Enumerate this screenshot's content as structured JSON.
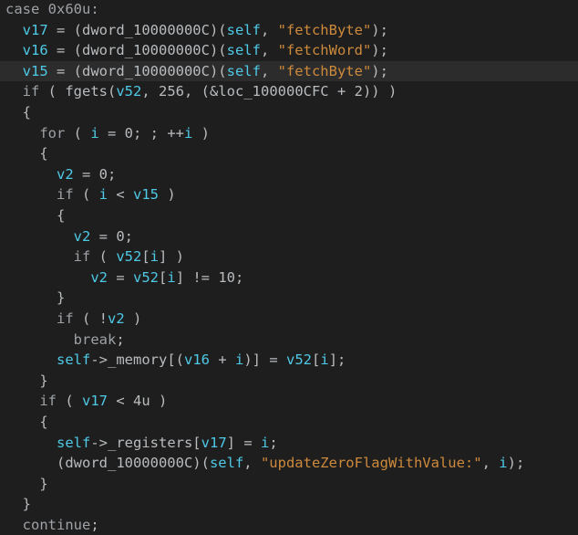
{
  "colors": {
    "background": "#1e1e1e",
    "highlight_line": "#2c2c2c",
    "keyword": "#9ea2a6",
    "variable": "#4ec9e6",
    "string": "#ce8a3c",
    "plain": "#b9bcbf"
  },
  "editor": {
    "highlighted_line": 3,
    "lines": [
      [
        {
          "t": "kw",
          "v": "case 0x60u:"
        }
      ],
      [
        {
          "t": "plain",
          "v": "  "
        },
        {
          "t": "var",
          "v": "v17"
        },
        {
          "t": "plain",
          "v": " = (dword_10000000C)("
        },
        {
          "t": "var",
          "v": "self"
        },
        {
          "t": "plain",
          "v": ", "
        },
        {
          "t": "str",
          "v": "\"fetchByte\""
        },
        {
          "t": "plain",
          "v": ");"
        }
      ],
      [
        {
          "t": "plain",
          "v": "  "
        },
        {
          "t": "var",
          "v": "v16"
        },
        {
          "t": "plain",
          "v": " = (dword_10000000C)("
        },
        {
          "t": "var",
          "v": "self"
        },
        {
          "t": "plain",
          "v": ", "
        },
        {
          "t": "str",
          "v": "\"fetchWord\""
        },
        {
          "t": "plain",
          "v": ");"
        }
      ],
      [
        {
          "t": "plain",
          "v": "  "
        },
        {
          "t": "var",
          "v": "v15"
        },
        {
          "t": "plain",
          "v": " = (dword_10000000C)("
        },
        {
          "t": "var",
          "v": "self"
        },
        {
          "t": "plain",
          "v": ", "
        },
        {
          "t": "str",
          "v": "\"fetchByte\""
        },
        {
          "t": "plain",
          "v": ");"
        }
      ],
      [
        {
          "t": "plain",
          "v": "  "
        },
        {
          "t": "kw",
          "v": "if"
        },
        {
          "t": "plain",
          "v": " ( fgets("
        },
        {
          "t": "var",
          "v": "v52"
        },
        {
          "t": "plain",
          "v": ", 256, (&loc_100000CFC + 2)) )"
        }
      ],
      [
        {
          "t": "plain",
          "v": "  {"
        }
      ],
      [
        {
          "t": "plain",
          "v": "    "
        },
        {
          "t": "kw",
          "v": "for"
        },
        {
          "t": "plain",
          "v": " ( "
        },
        {
          "t": "var",
          "v": "i"
        },
        {
          "t": "plain",
          "v": " = 0; ; ++"
        },
        {
          "t": "var",
          "v": "i"
        },
        {
          "t": "plain",
          "v": " )"
        }
      ],
      [
        {
          "t": "plain",
          "v": "    {"
        }
      ],
      [
        {
          "t": "plain",
          "v": "      "
        },
        {
          "t": "var",
          "v": "v2"
        },
        {
          "t": "plain",
          "v": " = 0;"
        }
      ],
      [
        {
          "t": "plain",
          "v": "      "
        },
        {
          "t": "kw",
          "v": "if"
        },
        {
          "t": "plain",
          "v": " ( "
        },
        {
          "t": "var",
          "v": "i"
        },
        {
          "t": "plain",
          "v": " < "
        },
        {
          "t": "var",
          "v": "v15"
        },
        {
          "t": "plain",
          "v": " )"
        }
      ],
      [
        {
          "t": "plain",
          "v": "      {"
        }
      ],
      [
        {
          "t": "plain",
          "v": "        "
        },
        {
          "t": "var",
          "v": "v2"
        },
        {
          "t": "plain",
          "v": " = 0;"
        }
      ],
      [
        {
          "t": "plain",
          "v": "        "
        },
        {
          "t": "kw",
          "v": "if"
        },
        {
          "t": "plain",
          "v": " ( "
        },
        {
          "t": "var",
          "v": "v52"
        },
        {
          "t": "plain",
          "v": "["
        },
        {
          "t": "var",
          "v": "i"
        },
        {
          "t": "plain",
          "v": "] )"
        }
      ],
      [
        {
          "t": "plain",
          "v": "          "
        },
        {
          "t": "var",
          "v": "v2"
        },
        {
          "t": "plain",
          "v": " = "
        },
        {
          "t": "var",
          "v": "v52"
        },
        {
          "t": "plain",
          "v": "["
        },
        {
          "t": "var",
          "v": "i"
        },
        {
          "t": "plain",
          "v": "] != 10;"
        }
      ],
      [
        {
          "t": "plain",
          "v": "      }"
        }
      ],
      [
        {
          "t": "plain",
          "v": "      "
        },
        {
          "t": "kw",
          "v": "if"
        },
        {
          "t": "plain",
          "v": " ( !"
        },
        {
          "t": "var",
          "v": "v2"
        },
        {
          "t": "plain",
          "v": " )"
        }
      ],
      [
        {
          "t": "plain",
          "v": "        "
        },
        {
          "t": "kw",
          "v": "break"
        },
        {
          "t": "plain",
          "v": ";"
        }
      ],
      [
        {
          "t": "plain",
          "v": "      "
        },
        {
          "t": "var",
          "v": "self"
        },
        {
          "t": "plain",
          "v": "->_memory[("
        },
        {
          "t": "var",
          "v": "v16"
        },
        {
          "t": "plain",
          "v": " + "
        },
        {
          "t": "var",
          "v": "i"
        },
        {
          "t": "plain",
          "v": ")] = "
        },
        {
          "t": "var",
          "v": "v52"
        },
        {
          "t": "plain",
          "v": "["
        },
        {
          "t": "var",
          "v": "i"
        },
        {
          "t": "plain",
          "v": "];"
        }
      ],
      [
        {
          "t": "plain",
          "v": "    }"
        }
      ],
      [
        {
          "t": "plain",
          "v": "    "
        },
        {
          "t": "kw",
          "v": "if"
        },
        {
          "t": "plain",
          "v": " ( "
        },
        {
          "t": "var",
          "v": "v17"
        },
        {
          "t": "plain",
          "v": " < 4u )"
        }
      ],
      [
        {
          "t": "plain",
          "v": "    {"
        }
      ],
      [
        {
          "t": "plain",
          "v": "      "
        },
        {
          "t": "var",
          "v": "self"
        },
        {
          "t": "plain",
          "v": "->_registers["
        },
        {
          "t": "var",
          "v": "v17"
        },
        {
          "t": "plain",
          "v": "] = "
        },
        {
          "t": "var",
          "v": "i"
        },
        {
          "t": "plain",
          "v": ";"
        }
      ],
      [
        {
          "t": "plain",
          "v": "      (dword_10000000C)("
        },
        {
          "t": "var",
          "v": "self"
        },
        {
          "t": "plain",
          "v": ", "
        },
        {
          "t": "str",
          "v": "\"updateZeroFlagWithValue:\""
        },
        {
          "t": "plain",
          "v": ", "
        },
        {
          "t": "var",
          "v": "i"
        },
        {
          "t": "plain",
          "v": ");"
        }
      ],
      [
        {
          "t": "plain",
          "v": "    }"
        }
      ],
      [
        {
          "t": "plain",
          "v": "  }"
        }
      ],
      [
        {
          "t": "plain",
          "v": "  "
        },
        {
          "t": "kw",
          "v": "continue"
        },
        {
          "t": "plain",
          "v": ";"
        }
      ]
    ]
  }
}
